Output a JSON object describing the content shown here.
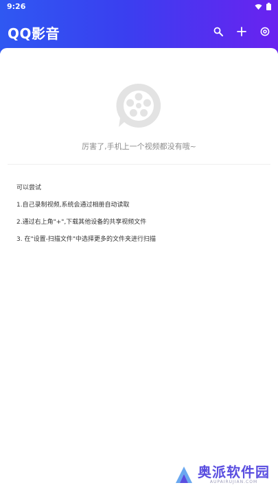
{
  "status_bar": {
    "time": "9:26"
  },
  "header": {
    "title": "QQ影音",
    "gradient_colors": [
      "#2f58f2",
      "#6a22f0"
    ],
    "actions": [
      {
        "icon": "search-icon"
      },
      {
        "icon": "plus-icon"
      },
      {
        "icon": "settings-icon"
      }
    ]
  },
  "empty_state": {
    "icon": "film-reel-icon",
    "message": "厉害了,手机上一个视频都没有哦~"
  },
  "tips": {
    "title": "可以尝试",
    "items": [
      "1.自己录制视频,系统会通过相册自动读取",
      "2.通过右上角\"+\",下载其他设备的共享视频文件",
      "3. 在\"设置-扫描文件\"中选择更多的文件夹进行扫描"
    ]
  },
  "watermark": {
    "name": "奥派软件园",
    "url": "AUPAIRUJIAN.COM",
    "color": "#5a4ee0"
  }
}
